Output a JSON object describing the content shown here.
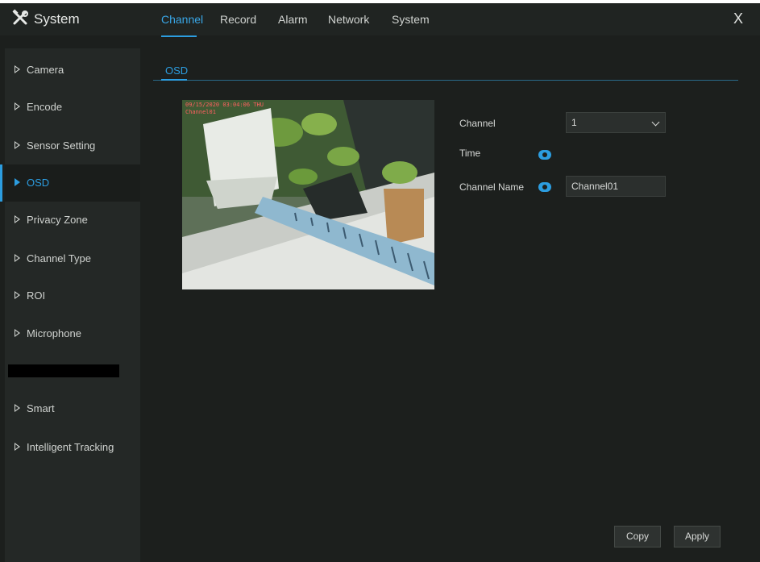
{
  "app": {
    "title": "System"
  },
  "tabs": [
    {
      "label": "Channel",
      "active": true
    },
    {
      "label": "Record",
      "active": false
    },
    {
      "label": "Alarm",
      "active": false
    },
    {
      "label": "Network",
      "active": false
    },
    {
      "label": "System",
      "active": false
    }
  ],
  "close_label": "X",
  "sidebar": {
    "items": [
      {
        "label": "Camera"
      },
      {
        "label": "Encode"
      },
      {
        "label": "Sensor Setting"
      },
      {
        "label": "OSD",
        "active": true
      },
      {
        "label": "Privacy Zone"
      },
      {
        "label": "Channel Type"
      },
      {
        "label": "ROI"
      },
      {
        "label": "Microphone"
      },
      {
        "label": "",
        "redacted": true
      },
      {
        "label": "Smart"
      },
      {
        "label": "Intelligent Tracking"
      }
    ]
  },
  "section": {
    "tab": "OSD"
  },
  "preview": {
    "osd_time": "09/15/2020 03:04:06 THU",
    "osd_name": "Channel01"
  },
  "form": {
    "channel_label": "Channel",
    "channel_value": "1",
    "time_label": "Time",
    "time_enabled": true,
    "channel_name_label": "Channel Name",
    "channel_name_enabled": true,
    "channel_name_value": "Channel01"
  },
  "buttons": {
    "copy": "Copy",
    "apply": "Apply"
  },
  "colors": {
    "accent": "#2c9de0",
    "background": "#1c1f1d",
    "sidebar": "#242826"
  }
}
